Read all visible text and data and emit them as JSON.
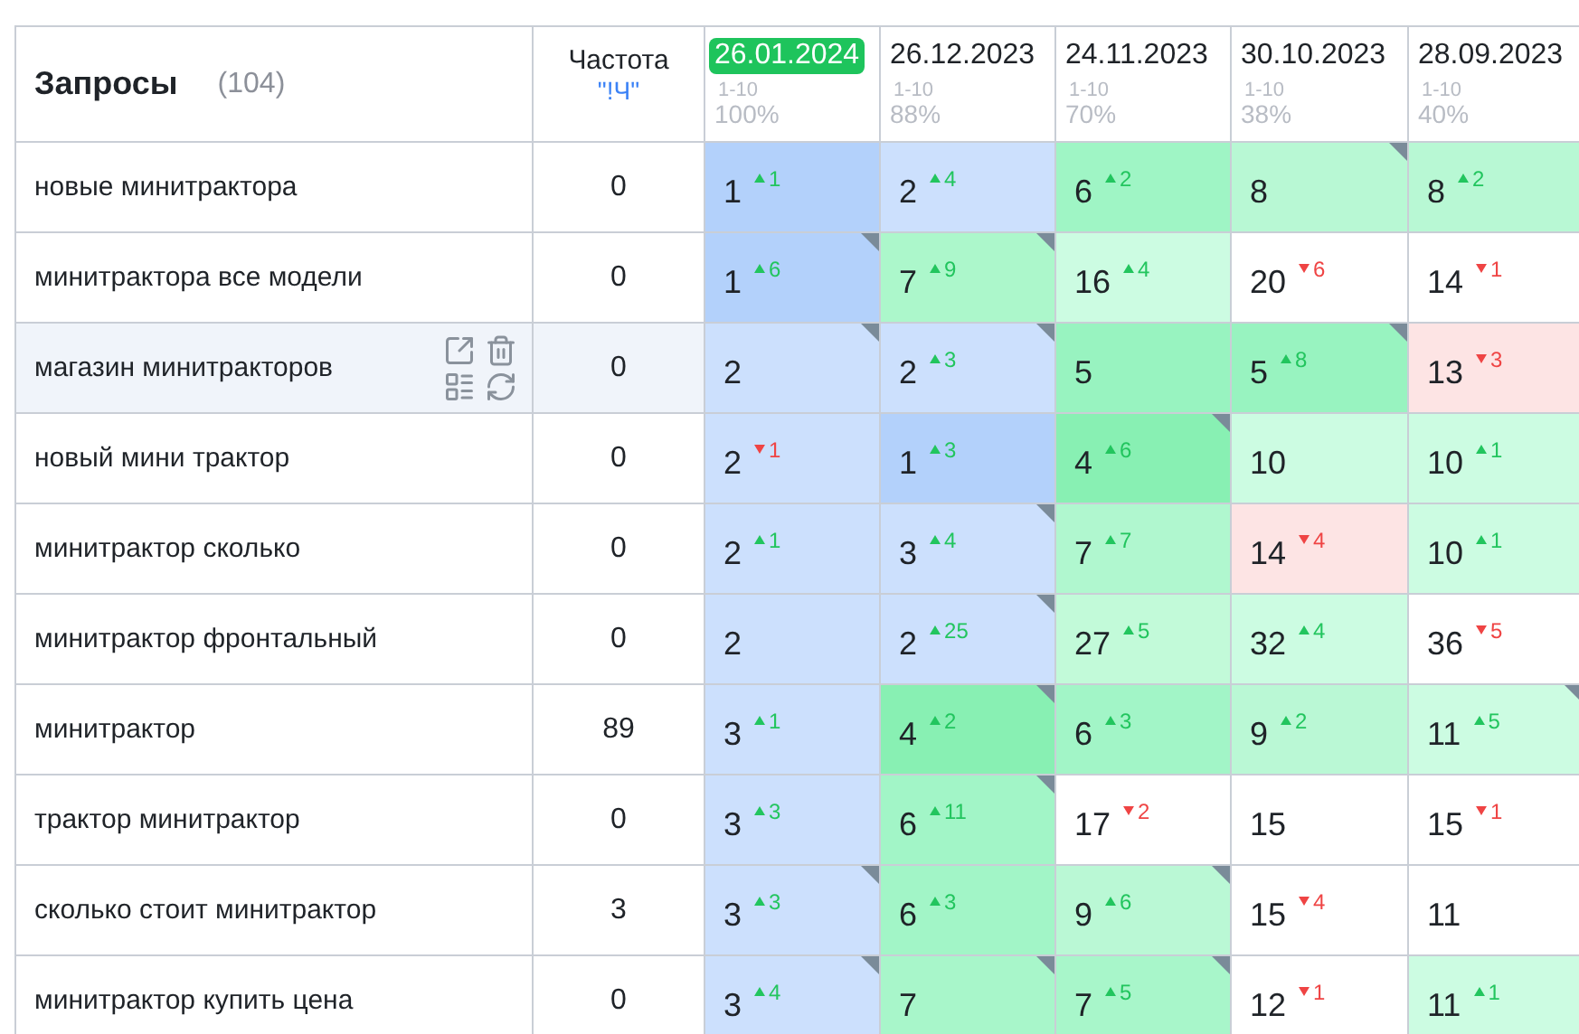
{
  "header": {
    "title": "Запросы",
    "count": "(104)",
    "frequency_label": "Частота",
    "frequency_mode": "\"!Ч\""
  },
  "dates": [
    {
      "date": "26.01.2024",
      "range": "1-10",
      "percent": "100%",
      "selected": true
    },
    {
      "date": "26.12.2023",
      "range": "1-10",
      "percent": "88%",
      "selected": false
    },
    {
      "date": "24.11.2023",
      "range": "1-10",
      "percent": "70%",
      "selected": false
    },
    {
      "date": "30.10.2023",
      "range": "1-10",
      "percent": "38%",
      "selected": false
    },
    {
      "date": "28.09.2023",
      "range": "1-10",
      "percent": "40%",
      "selected": false
    }
  ],
  "rows": [
    {
      "query": "новые минитрактора",
      "frequency": "0",
      "highlighted": false,
      "cells": [
        {
          "value": "1",
          "change": "1",
          "rising": true,
          "color": "#b3d1fb",
          "flagged": false
        },
        {
          "value": "2",
          "change": "4",
          "rising": true,
          "color": "#cce0fd",
          "flagged": false
        },
        {
          "value": "6",
          "change": "2",
          "rising": true,
          "color": "#9ff5c5",
          "flagged": false
        },
        {
          "value": "8",
          "color": "#b8f8d4",
          "flagged": true
        },
        {
          "value": "8",
          "change": "2",
          "rising": true,
          "color": "#b8f8d4",
          "flagged": false
        }
      ]
    },
    {
      "query": "минитрактора все модели",
      "frequency": "0",
      "highlighted": false,
      "cells": [
        {
          "value": "1",
          "change": "6",
          "rising": true,
          "color": "#b3d1fb",
          "flagged": true
        },
        {
          "value": "7",
          "change": "9",
          "rising": true,
          "color": "#acf7cb",
          "flagged": true
        },
        {
          "value": "16",
          "change": "4",
          "rising": true,
          "color": "#ccfce2",
          "flagged": false
        },
        {
          "value": "20",
          "change": "6",
          "rising": false,
          "color": "#ffffff",
          "flagged": false
        },
        {
          "value": "14",
          "change": "1",
          "rising": false,
          "color": "#ffffff",
          "flagged": false
        }
      ]
    },
    {
      "query": "магазин минитракторов",
      "frequency": "0",
      "highlighted": true,
      "cells": [
        {
          "value": "2",
          "color": "#cce0fd",
          "flagged": true
        },
        {
          "value": "2",
          "change": "3",
          "rising": true,
          "color": "#cce0fd",
          "flagged": true
        },
        {
          "value": "5",
          "color": "#98f3c0",
          "flagged": false
        },
        {
          "value": "5",
          "change": "8",
          "rising": true,
          "color": "#98f3c0",
          "flagged": true
        },
        {
          "value": "13",
          "change": "3",
          "rising": false,
          "color": "#fde4e4",
          "flagged": false
        }
      ]
    },
    {
      "query": "новый мини трактор",
      "frequency": "0",
      "highlighted": false,
      "cells": [
        {
          "value": "2",
          "change": "1",
          "rising": false,
          "color": "#cce0fd",
          "flagged": false
        },
        {
          "value": "1",
          "change": "3",
          "rising": true,
          "color": "#b3d1fb",
          "flagged": false
        },
        {
          "value": "4",
          "change": "6",
          "rising": true,
          "color": "#88f0b3",
          "flagged": true
        },
        {
          "value": "10",
          "color": "#ccfce2",
          "flagged": false
        },
        {
          "value": "10",
          "change": "1",
          "rising": true,
          "color": "#ccfce2",
          "flagged": false
        }
      ]
    },
    {
      "query": "минитрактор сколько",
      "frequency": "0",
      "highlighted": false,
      "cells": [
        {
          "value": "2",
          "change": "1",
          "rising": true,
          "color": "#cce0fd",
          "flagged": false
        },
        {
          "value": "3",
          "change": "4",
          "rising": true,
          "color": "#cce0fd",
          "flagged": true
        },
        {
          "value": "7",
          "change": "7",
          "rising": true,
          "color": "#b0f7cf",
          "flagged": false
        },
        {
          "value": "14",
          "change": "4",
          "rising": false,
          "color": "#fde4e4",
          "flagged": false
        },
        {
          "value": "10",
          "change": "1",
          "rising": true,
          "color": "#ccfce2",
          "flagged": false
        }
      ]
    },
    {
      "query": "минитрактор фронтальный",
      "frequency": "0",
      "highlighted": false,
      "cells": [
        {
          "value": "2",
          "color": "#cce0fd",
          "flagged": false
        },
        {
          "value": "2",
          "change": "25",
          "rising": true,
          "color": "#cce0fd",
          "flagged": true
        },
        {
          "value": "27",
          "change": "5",
          "rising": true,
          "color": "#c2fad9",
          "flagged": false
        },
        {
          "value": "32",
          "change": "4",
          "rising": true,
          "color": "#ccfce2",
          "flagged": false
        },
        {
          "value": "36",
          "change": "5",
          "rising": false,
          "color": "#ffffff",
          "flagged": false
        }
      ]
    },
    {
      "query": "минитрактор",
      "frequency": "89",
      "highlighted": false,
      "cells": [
        {
          "value": "3",
          "change": "1",
          "rising": true,
          "color": "#cce0fd",
          "flagged": false
        },
        {
          "value": "4",
          "change": "2",
          "rising": true,
          "color": "#88f0b3",
          "flagged": true
        },
        {
          "value": "6",
          "change": "3",
          "rising": true,
          "color": "#a2f5c7",
          "flagged": false
        },
        {
          "value": "9",
          "change": "2",
          "rising": true,
          "color": "#baf8d5",
          "flagged": false
        },
        {
          "value": "11",
          "change": "5",
          "rising": true,
          "color": "#ccfce2",
          "flagged": true
        }
      ]
    },
    {
      "query": "трактор минитрактор",
      "frequency": "0",
      "highlighted": false,
      "cells": [
        {
          "value": "3",
          "change": "3",
          "rising": true,
          "color": "#cce0fd",
          "flagged": false
        },
        {
          "value": "6",
          "change": "11",
          "rising": true,
          "color": "#a2f5c7",
          "flagged": true
        },
        {
          "value": "17",
          "change": "2",
          "rising": false,
          "color": "#ffffff",
          "flagged": false
        },
        {
          "value": "15",
          "color": "#ffffff",
          "flagged": false
        },
        {
          "value": "15",
          "change": "1",
          "rising": false,
          "color": "#ffffff",
          "flagged": false
        }
      ]
    },
    {
      "query": "сколько стоит минитрактор",
      "frequency": "3",
      "highlighted": false,
      "cells": [
        {
          "value": "3",
          "change": "3",
          "rising": true,
          "color": "#cce0fd",
          "flagged": true
        },
        {
          "value": "6",
          "change": "3",
          "rising": true,
          "color": "#a2f5c7",
          "flagged": false
        },
        {
          "value": "9",
          "change": "6",
          "rising": true,
          "color": "#baf8d5",
          "flagged": true
        },
        {
          "value": "15",
          "change": "4",
          "rising": false,
          "color": "#ffffff",
          "flagged": false
        },
        {
          "value": "11",
          "color": "#ffffff",
          "flagged": false
        }
      ]
    },
    {
      "query": "минитрактор купить цена",
      "frequency": "0",
      "highlighted": false,
      "cells": [
        {
          "value": "3",
          "change": "4",
          "rising": true,
          "color": "#cce0fd",
          "flagged": true
        },
        {
          "value": "7",
          "color": "#a8f6ca",
          "flagged": true
        },
        {
          "value": "7",
          "change": "5",
          "rising": true,
          "color": "#a8f6ca",
          "flagged": true
        },
        {
          "value": "12",
          "change": "1",
          "rising": false,
          "color": "#ffffff",
          "flagged": false
        },
        {
          "value": "11",
          "change": "1",
          "rising": true,
          "color": "#ccfce2",
          "flagged": false
        }
      ]
    }
  ]
}
